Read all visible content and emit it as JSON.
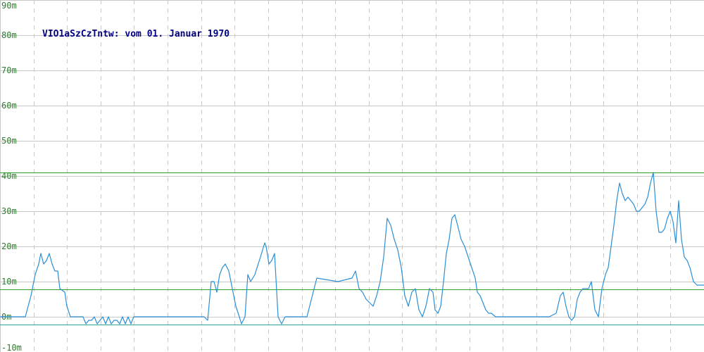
{
  "chart_data": {
    "type": "line",
    "title": "VIO1aSzCzTntw: vom 01. Januar 1970",
    "xlabel": "",
    "ylabel": "",
    "ylim": [
      -10,
      90
    ],
    "y_ticks": [
      90,
      80,
      70,
      60,
      50,
      40,
      30,
      20,
      10,
      0,
      -10
    ],
    "y_tick_labels": [
      "90m",
      "80m",
      "70m",
      "60m",
      "50m",
      "40m",
      "30m",
      "20m",
      "10m",
      "0m",
      "-10m"
    ],
    "grid": true,
    "vertical_gridlines": 21,
    "reference_lines": [
      {
        "value": 41,
        "color": "#2e9e2e"
      },
      {
        "value": 7.8,
        "color": "#2e9e2e"
      },
      {
        "value": -2.2,
        "color": "#2e9e9e"
      }
    ],
    "series": [
      {
        "color": "#2a8fd6",
        "x": [
          0,
          36,
          44,
          50,
          55,
          58,
          62,
          66,
          70,
          74,
          78,
          82,
          85,
          92,
          95,
          100,
          110,
          118,
          122,
          126,
          130,
          134,
          138,
          142,
          146,
          150,
          154,
          158,
          162,
          166,
          170,
          174,
          178,
          182,
          186,
          190,
          200,
          240,
          280,
          290,
          295,
          300,
          304,
          308,
          312,
          316,
          320,
          325,
          330,
          335,
          340,
          343,
          348,
          352,
          356,
          362,
          370,
          376,
          378,
          382,
          386,
          390,
          395,
          400,
          405,
          409,
          413,
          418,
          422,
          425,
          428,
          431,
          436,
          450,
          480,
          500,
          505,
          510,
          515,
          520,
          525,
          530,
          535,
          540,
          545,
          550,
          555,
          560,
          565,
          570,
          575,
          580,
          585,
          590,
          595,
          600,
          605,
          610,
          615,
          618,
          622,
          626,
          630,
          634,
          638,
          642,
          646,
          650,
          655,
          660,
          665,
          670,
          675,
          678,
          682,
          686,
          690,
          694,
          698,
          704,
          710,
          716,
          722,
          728,
          732,
          740,
          750,
          760,
          770,
          780,
          790,
          796,
          800,
          804,
          808,
          812,
          816,
          820,
          824,
          828,
          832,
          836,
          840,
          845,
          850,
          855,
          860,
          864,
          868,
          872,
          876,
          880,
          884,
          888,
          892,
          896,
          900,
          904,
          908,
          912,
          916,
          920,
          924,
          928,
          932,
          936,
          940,
          944,
          948,
          952,
          956,
          960,
          964,
          968,
          972,
          976,
          980,
          985,
          990,
          995,
          1000
        ],
        "y": [
          0,
          0,
          6,
          12,
          15,
          18,
          15,
          16,
          18,
          15,
          13,
          13,
          8,
          7,
          3,
          0,
          0,
          0,
          -2,
          -1,
          -1,
          0,
          -2,
          -1,
          0,
          -2,
          0,
          -2,
          -1,
          -1,
          -2,
          0,
          -2,
          0,
          -2,
          0,
          0,
          0,
          0,
          0,
          -1,
          10,
          10,
          7,
          12,
          14,
          15,
          13,
          8,
          3,
          0,
          -2,
          0,
          12,
          10,
          12,
          17,
          21,
          20,
          15,
          16,
          18,
          0,
          -2,
          0,
          0,
          0,
          0,
          0,
          0,
          0,
          0,
          0,
          11,
          10,
          11,
          13,
          8,
          7,
          5,
          4,
          3,
          6,
          10,
          17,
          28,
          26,
          22,
          19,
          14,
          6,
          3,
          7,
          8,
          2,
          0,
          3,
          8,
          7,
          2,
          1,
          3,
          10,
          18,
          22,
          28,
          29,
          26,
          22,
          20,
          17,
          14,
          11,
          7,
          6,
          4,
          2,
          1,
          1,
          0,
          0,
          0,
          0,
          0,
          0,
          0,
          0,
          0,
          0,
          0,
          1,
          6,
          7,
          3,
          0,
          -1,
          0,
          5,
          7,
          8,
          8,
          8,
          10,
          2,
          0,
          8,
          12,
          14,
          20,
          26,
          33,
          38,
          35,
          33,
          34,
          33,
          32,
          30,
          30,
          31,
          32,
          34,
          38,
          41,
          30,
          24,
          24,
          25,
          28,
          30,
          27,
          21,
          33,
          22,
          17,
          16,
          14,
          10,
          9,
          9,
          9
        ]
      }
    ]
  }
}
